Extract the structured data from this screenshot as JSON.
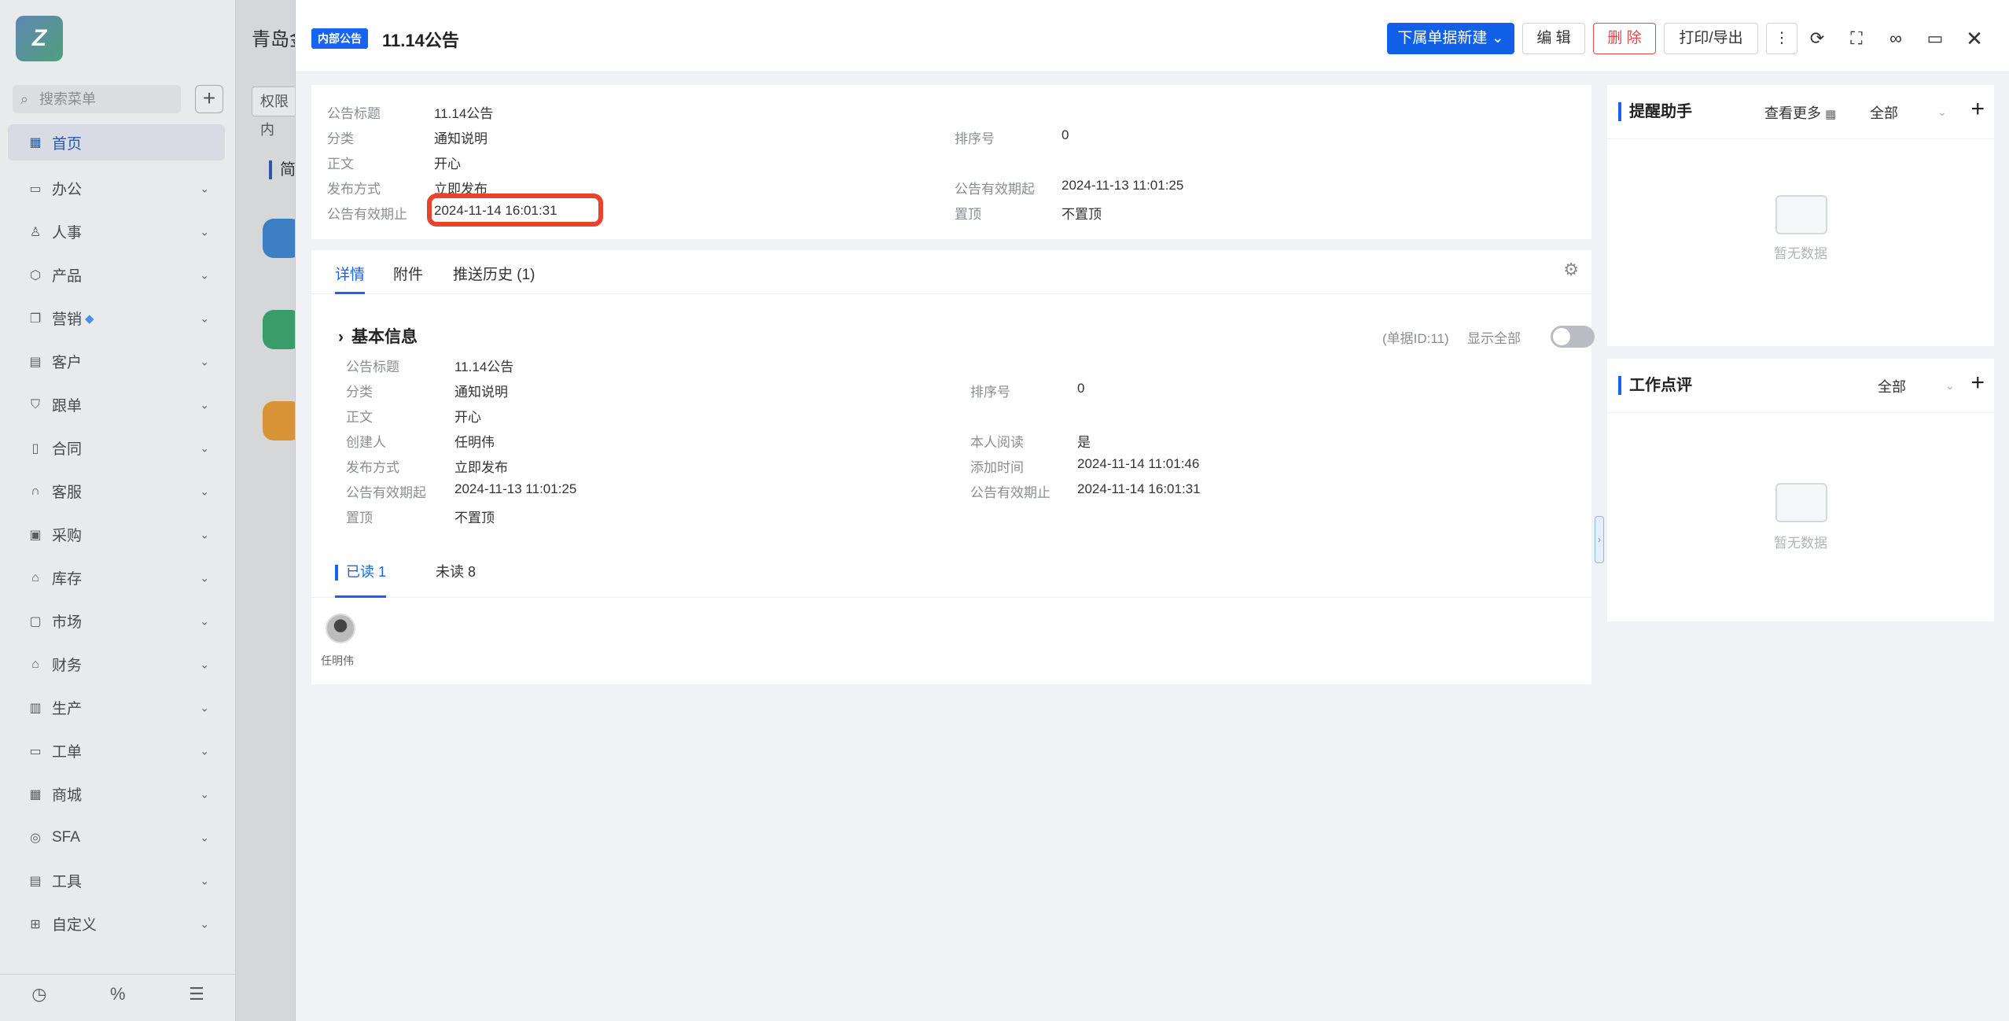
{
  "sidebar": {
    "logo_text": "Z",
    "search_placeholder": "搜索菜单",
    "items": [
      {
        "label": "首页",
        "icon": "home-icon"
      },
      {
        "label": "办公",
        "icon": "monitor-icon"
      },
      {
        "label": "人事",
        "icon": "people-icon"
      },
      {
        "label": "产品",
        "icon": "box-icon"
      },
      {
        "label": "营销",
        "icon": "copy-icon"
      },
      {
        "label": "客户",
        "icon": "chart-icon"
      },
      {
        "label": "跟单",
        "icon": "shield-icon"
      },
      {
        "label": "合同",
        "icon": "document-icon"
      },
      {
        "label": "客服",
        "icon": "headset-icon"
      },
      {
        "label": "采购",
        "icon": "cart-icon"
      },
      {
        "label": "库存",
        "icon": "warehouse-icon"
      },
      {
        "label": "市场",
        "icon": "market-icon"
      },
      {
        "label": "财务",
        "icon": "bank-icon"
      },
      {
        "label": "生产",
        "icon": "factory-icon"
      },
      {
        "label": "工单",
        "icon": "ticket-icon"
      },
      {
        "label": "商城",
        "icon": "store-icon"
      },
      {
        "label": "SFA",
        "icon": "target-icon"
      },
      {
        "label": "工具",
        "icon": "toolbox-icon"
      },
      {
        "label": "自定义",
        "icon": "grid-icon"
      }
    ]
  },
  "background": {
    "title": "青岛金",
    "tab_label": "权限内",
    "section_label": "简"
  },
  "header": {
    "badge": "内部公告",
    "title": "11.14公告",
    "new_sub_label": "下属单据新建",
    "edit_label": "编 辑",
    "delete_label": "删 除",
    "print_label": "打印/导出"
  },
  "summary": {
    "left": [
      {
        "key": "公告标题",
        "value": "11.14公告"
      },
      {
        "key": "分类",
        "value": "通知说明"
      },
      {
        "key": "正文",
        "value": "开心"
      },
      {
        "key": "发布方式",
        "value": "立即发布"
      },
      {
        "key": "公告有效期止",
        "value": "2024-11-14 16:01:31"
      }
    ],
    "right": [
      {
        "key": "排序号",
        "value": "0"
      },
      {
        "key": "公告有效期起",
        "value": "2024-11-13 11:01:25"
      },
      {
        "key": "置顶",
        "value": "不置顶"
      }
    ]
  },
  "tabs": [
    "详情",
    "附件",
    "推送历史 (1)"
  ],
  "basic": {
    "title": "基本信息",
    "bill_id": "(单据ID:11)",
    "show_all": "显示全部",
    "left": [
      {
        "key": "公告标题",
        "value": "11.14公告"
      },
      {
        "key": "分类",
        "value": "通知说明"
      },
      {
        "key": "正文",
        "value": "开心"
      },
      {
        "key": "创建人",
        "value": "任明伟"
      },
      {
        "key": "发布方式",
        "value": "立即发布"
      },
      {
        "key": "公告有效期起",
        "value": "2024-11-13 11:01:25"
      },
      {
        "key": "置顶",
        "value": "不置顶"
      }
    ],
    "right": [
      {
        "key": "排序号",
        "value": "0"
      },
      {
        "key": "本人阅读",
        "value": "是"
      },
      {
        "key": "添加时间",
        "value": "2024-11-14 11:01:46"
      },
      {
        "key": "公告有效期止",
        "value": "2024-11-14 16:01:31"
      }
    ]
  },
  "read_tabs": {
    "read": "已读 1",
    "unread": "未读 8"
  },
  "reader": {
    "name": "任明伟"
  },
  "reminder": {
    "title": "提醒助手",
    "more": "查看更多",
    "filter": "全部",
    "empty": "暂无数据"
  },
  "review": {
    "title": "工作点评",
    "filter": "全部",
    "empty": "暂无数据"
  }
}
